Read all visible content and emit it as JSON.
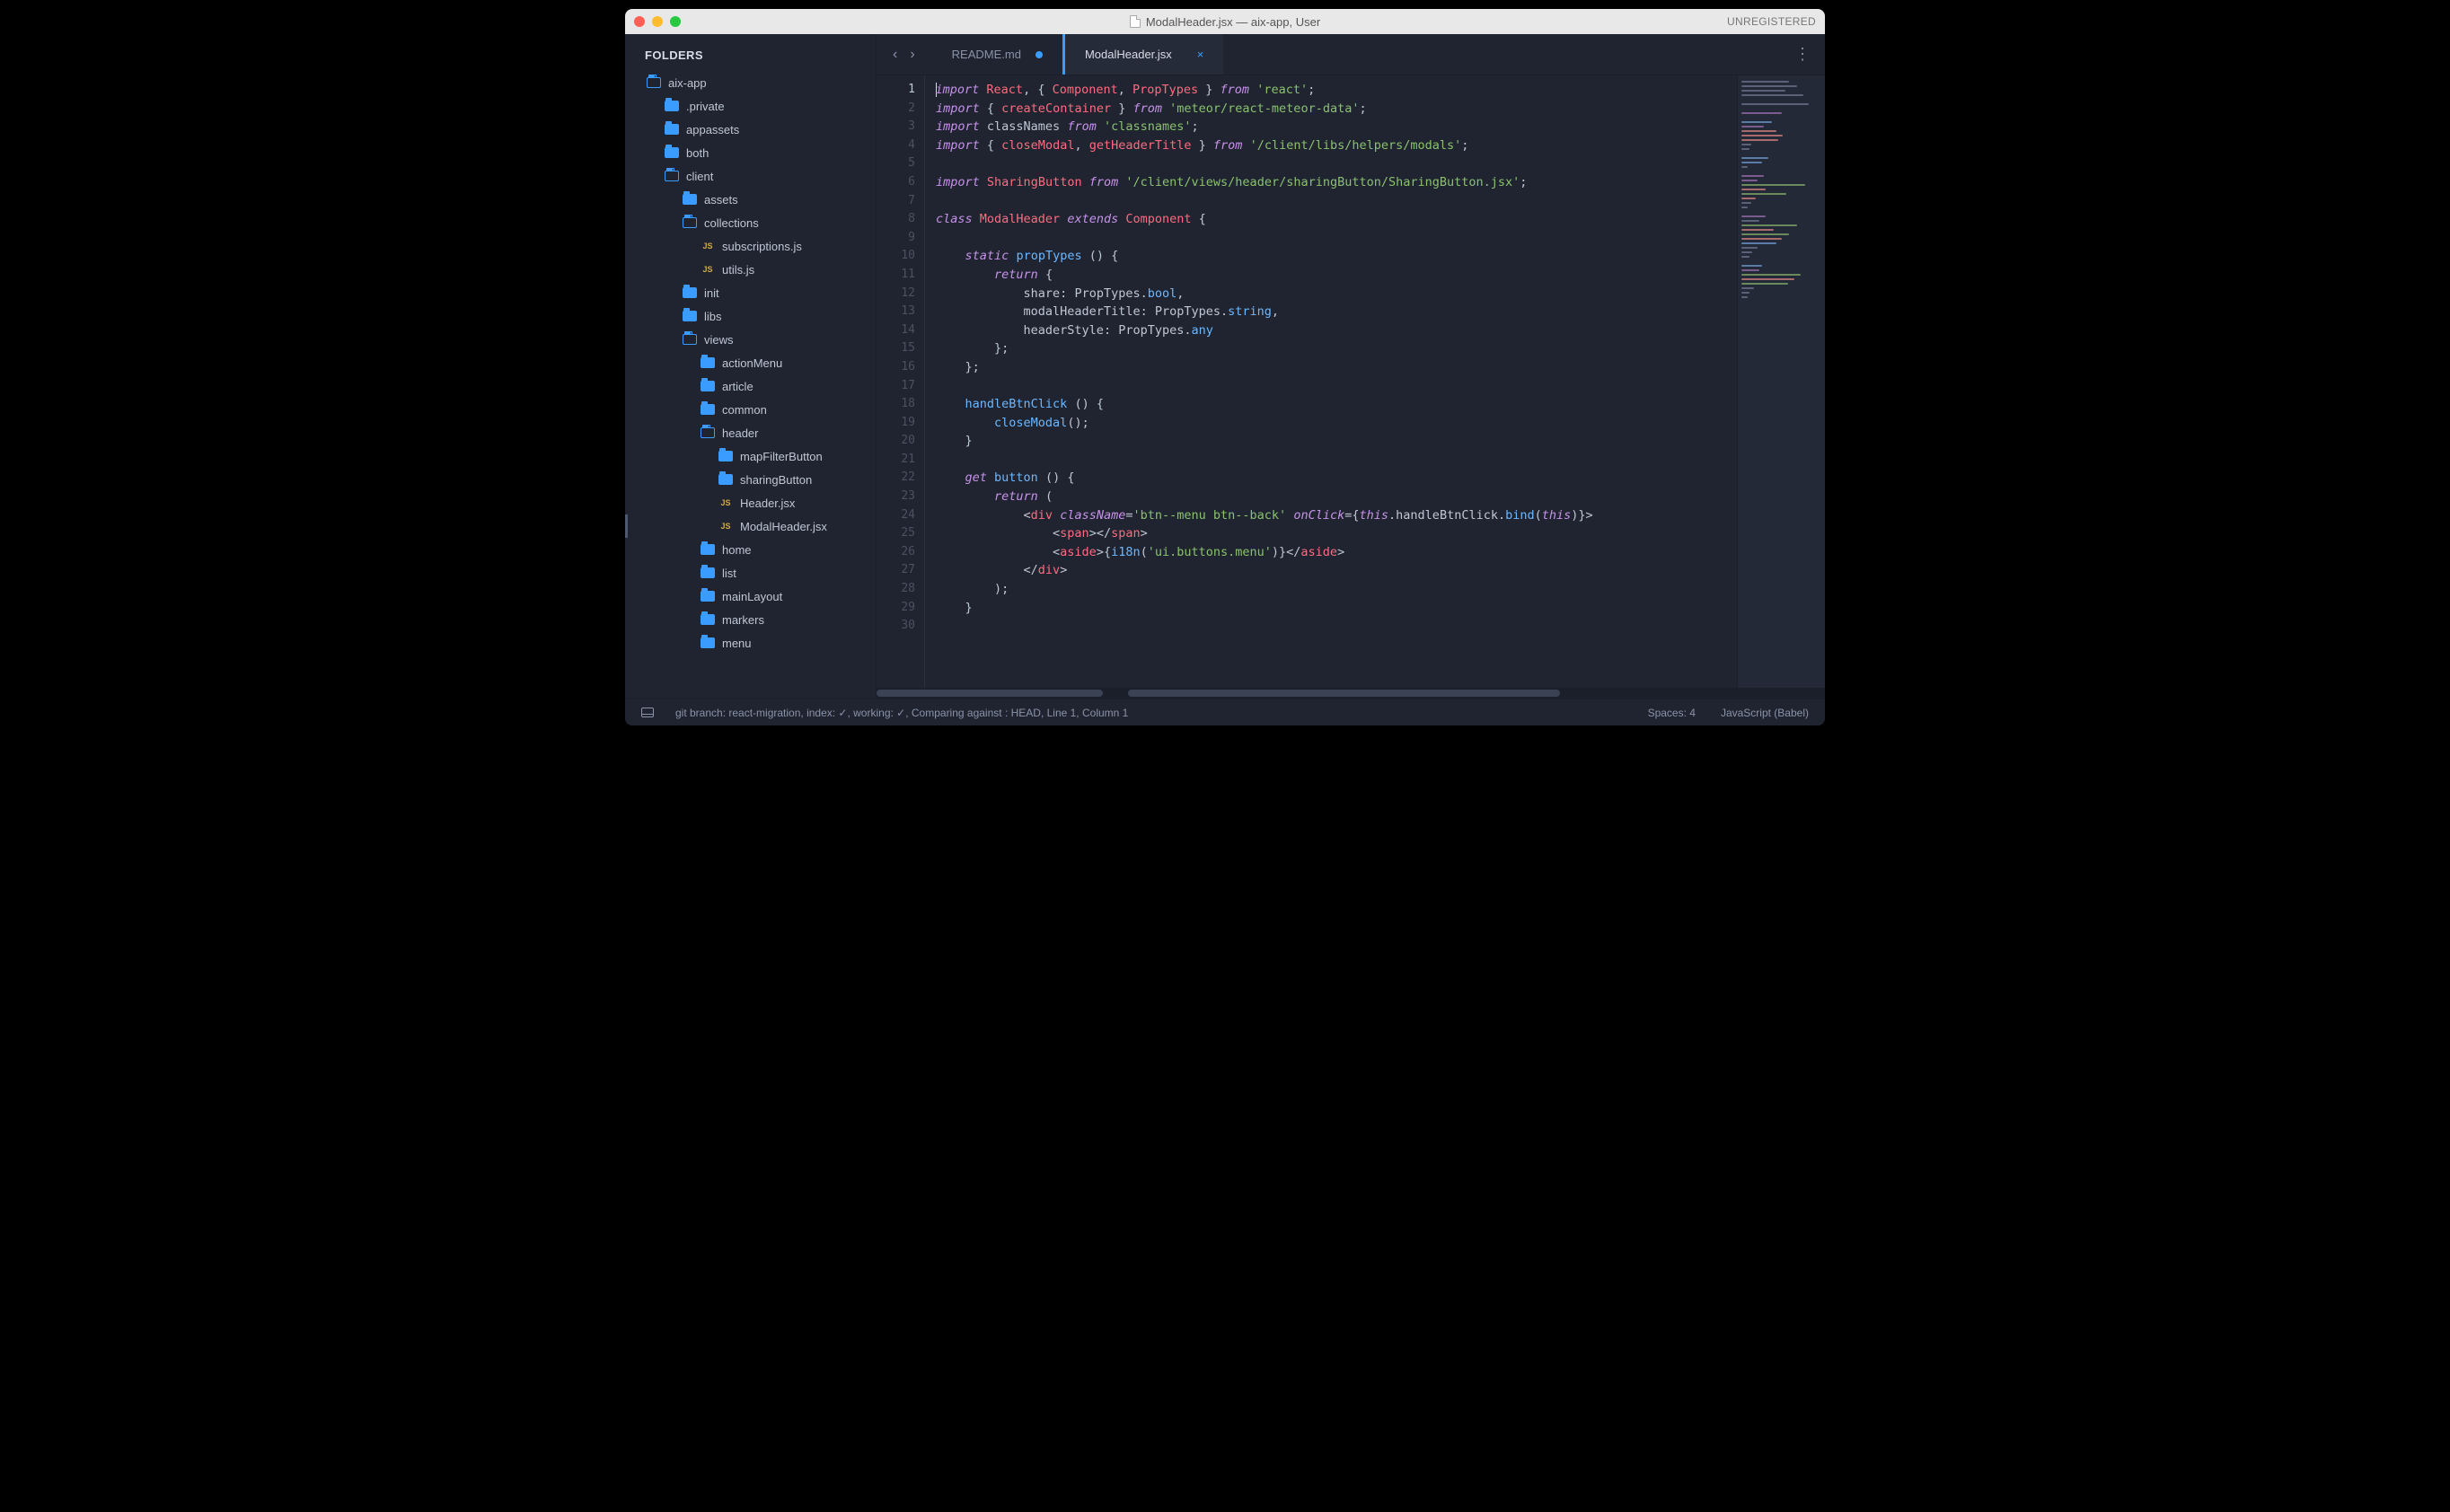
{
  "titlebar": {
    "title": "ModalHeader.jsx — aix-app, User",
    "unregistered": "UNREGISTERED"
  },
  "sidebar": {
    "header": "FOLDERS",
    "tree": [
      {
        "label": "aix-app",
        "type": "folder-open-outline",
        "indent": 24
      },
      {
        "label": ".private",
        "type": "folder",
        "indent": 44
      },
      {
        "label": "appassets",
        "type": "folder",
        "indent": 44
      },
      {
        "label": "both",
        "type": "folder",
        "indent": 44
      },
      {
        "label": "client",
        "type": "folder-open-outline",
        "indent": 44
      },
      {
        "label": "assets",
        "type": "folder",
        "indent": 64
      },
      {
        "label": "collections",
        "type": "folder-open-outline",
        "indent": 64
      },
      {
        "label": "subscriptions.js",
        "type": "js",
        "indent": 84
      },
      {
        "label": "utils.js",
        "type": "js",
        "indent": 84
      },
      {
        "label": "init",
        "type": "folder",
        "indent": 64
      },
      {
        "label": "libs",
        "type": "folder",
        "indent": 64
      },
      {
        "label": "views",
        "type": "folder-open-outline",
        "indent": 64
      },
      {
        "label": "actionMenu",
        "type": "folder",
        "indent": 84
      },
      {
        "label": "article",
        "type": "folder",
        "indent": 84
      },
      {
        "label": "common",
        "type": "folder",
        "indent": 84
      },
      {
        "label": "header",
        "type": "folder-open-outline",
        "indent": 84
      },
      {
        "label": "mapFilterButton",
        "type": "folder",
        "indent": 104
      },
      {
        "label": "sharingButton",
        "type": "folder",
        "indent": 104
      },
      {
        "label": "Header.jsx",
        "type": "js",
        "indent": 104
      },
      {
        "label": "ModalHeader.jsx",
        "type": "js",
        "indent": 104,
        "active": true
      },
      {
        "label": "home",
        "type": "folder",
        "indent": 84
      },
      {
        "label": "list",
        "type": "folder",
        "indent": 84
      },
      {
        "label": "mainLayout",
        "type": "folder",
        "indent": 84
      },
      {
        "label": "markers",
        "type": "folder",
        "indent": 84
      },
      {
        "label": "menu",
        "type": "folder",
        "indent": 84
      }
    ]
  },
  "tabs": [
    {
      "label": "README.md",
      "dirty": true,
      "active": false
    },
    {
      "label": "ModalHeader.jsx",
      "dirty": false,
      "active": true,
      "closable": true
    }
  ],
  "editor": {
    "lines": [
      [
        [
          "c-kw",
          "import"
        ],
        [
          "c-plain",
          " "
        ],
        [
          "c-type",
          "React"
        ],
        [
          "c-plain",
          ", { "
        ],
        [
          "c-type",
          "Component"
        ],
        [
          "c-plain",
          ", "
        ],
        [
          "c-type",
          "PropTypes"
        ],
        [
          "c-plain",
          " } "
        ],
        [
          "c-kw",
          "from"
        ],
        [
          "c-plain",
          " "
        ],
        [
          "c-str",
          "'react'"
        ],
        [
          "c-plain",
          ";"
        ]
      ],
      [
        [
          "c-kw",
          "import"
        ],
        [
          "c-plain",
          " { "
        ],
        [
          "c-type",
          "createContainer"
        ],
        [
          "c-plain",
          " } "
        ],
        [
          "c-kw",
          "from"
        ],
        [
          "c-plain",
          " "
        ],
        [
          "c-str",
          "'meteor/react-meteor-data'"
        ],
        [
          "c-plain",
          ";"
        ]
      ],
      [
        [
          "c-kw",
          "import"
        ],
        [
          "c-plain",
          " classNames "
        ],
        [
          "c-kw",
          "from"
        ],
        [
          "c-plain",
          " "
        ],
        [
          "c-str",
          "'classnames'"
        ],
        [
          "c-plain",
          ";"
        ]
      ],
      [
        [
          "c-kw",
          "import"
        ],
        [
          "c-plain",
          " { "
        ],
        [
          "c-type",
          "closeModal"
        ],
        [
          "c-plain",
          ", "
        ],
        [
          "c-type",
          "getHeaderTitle"
        ],
        [
          "c-plain",
          " } "
        ],
        [
          "c-kw",
          "from"
        ],
        [
          "c-plain",
          " "
        ],
        [
          "c-str",
          "'/client/libs/helpers/modals'"
        ],
        [
          "c-plain",
          ";"
        ]
      ],
      [],
      [
        [
          "c-kw",
          "import"
        ],
        [
          "c-plain",
          " "
        ],
        [
          "c-type",
          "SharingButton"
        ],
        [
          "c-plain",
          " "
        ],
        [
          "c-kw",
          "from"
        ],
        [
          "c-plain",
          " "
        ],
        [
          "c-str",
          "'/client/views/header/sharingButton/SharingButton.jsx'"
        ],
        [
          "c-plain",
          ";"
        ]
      ],
      [],
      [
        [
          "c-kw",
          "class"
        ],
        [
          "c-plain",
          " "
        ],
        [
          "c-type",
          "ModalHeader"
        ],
        [
          "c-plain",
          " "
        ],
        [
          "c-kw",
          "extends"
        ],
        [
          "c-plain",
          " "
        ],
        [
          "c-type",
          "Component"
        ],
        [
          "c-plain",
          " {"
        ]
      ],
      [],
      [
        [
          "c-plain",
          "    "
        ],
        [
          "c-kw",
          "static"
        ],
        [
          "c-plain",
          " "
        ],
        [
          "c-func",
          "propTypes"
        ],
        [
          "c-plain",
          " () {"
        ]
      ],
      [
        [
          "c-plain",
          "        "
        ],
        [
          "c-kw",
          "return"
        ],
        [
          "c-plain",
          " {"
        ]
      ],
      [
        [
          "c-plain",
          "            share"
        ],
        [
          "c-punc",
          ": "
        ],
        [
          "c-plain",
          "PropTypes"
        ],
        [
          "c-punc",
          "."
        ],
        [
          "c-func",
          "bool"
        ],
        [
          "c-punc",
          ","
        ]
      ],
      [
        [
          "c-plain",
          "            modalHeaderTitle"
        ],
        [
          "c-punc",
          ": "
        ],
        [
          "c-plain",
          "PropTypes"
        ],
        [
          "c-punc",
          "."
        ],
        [
          "c-func",
          "string"
        ],
        [
          "c-punc",
          ","
        ]
      ],
      [
        [
          "c-plain",
          "            headerStyle"
        ],
        [
          "c-punc",
          ": "
        ],
        [
          "c-plain",
          "PropTypes"
        ],
        [
          "c-punc",
          "."
        ],
        [
          "c-func",
          "any"
        ]
      ],
      [
        [
          "c-plain",
          "        };"
        ]
      ],
      [
        [
          "c-plain",
          "    };"
        ]
      ],
      [],
      [
        [
          "c-plain",
          "    "
        ],
        [
          "c-func",
          "handleBtnClick"
        ],
        [
          "c-plain",
          " () {"
        ]
      ],
      [
        [
          "c-plain",
          "        "
        ],
        [
          "c-func",
          "closeModal"
        ],
        [
          "c-plain",
          "();"
        ]
      ],
      [
        [
          "c-plain",
          "    }"
        ]
      ],
      [],
      [
        [
          "c-plain",
          "    "
        ],
        [
          "c-kw",
          "get"
        ],
        [
          "c-plain",
          " "
        ],
        [
          "c-func",
          "button"
        ],
        [
          "c-plain",
          " () {"
        ]
      ],
      [
        [
          "c-plain",
          "        "
        ],
        [
          "c-kw",
          "return"
        ],
        [
          "c-plain",
          " ("
        ]
      ],
      [
        [
          "c-plain",
          "            <"
        ],
        [
          "c-html",
          "div"
        ],
        [
          "c-plain",
          " "
        ],
        [
          "c-attr",
          "className"
        ],
        [
          "c-punc",
          "="
        ],
        [
          "c-str",
          "'btn--menu btn--back'"
        ],
        [
          "c-plain",
          " "
        ],
        [
          "c-attr",
          "onClick"
        ],
        [
          "c-punc",
          "="
        ],
        [
          "c-plain",
          "{"
        ],
        [
          "c-this",
          "this"
        ],
        [
          "c-punc",
          "."
        ],
        [
          "c-plain",
          "handleBtnClick"
        ],
        [
          "c-punc",
          "."
        ],
        [
          "c-func",
          "bind"
        ],
        [
          "c-plain",
          "("
        ],
        [
          "c-this",
          "this"
        ],
        [
          "c-plain",
          ")}>"
        ]
      ],
      [
        [
          "c-plain",
          "                <"
        ],
        [
          "c-html",
          "span"
        ],
        [
          "c-plain",
          "></"
        ],
        [
          "c-html",
          "span"
        ],
        [
          "c-plain",
          ">"
        ]
      ],
      [
        [
          "c-plain",
          "                <"
        ],
        [
          "c-html",
          "aside"
        ],
        [
          "c-plain",
          ">{"
        ],
        [
          "c-func",
          "i18n"
        ],
        [
          "c-plain",
          "("
        ],
        [
          "c-str",
          "'ui.buttons.menu'"
        ],
        [
          "c-plain",
          ")}</"
        ],
        [
          "c-html",
          "aside"
        ],
        [
          "c-plain",
          ">"
        ]
      ],
      [
        [
          "c-plain",
          "            </"
        ],
        [
          "c-html",
          "div"
        ],
        [
          "c-plain",
          ">"
        ]
      ],
      [
        [
          "c-plain",
          "        );"
        ]
      ],
      [
        [
          "c-plain",
          "    }"
        ]
      ],
      []
    ],
    "line_count": 30,
    "current_line": 1
  },
  "statusbar": {
    "left": "git branch: react-migration, index: ✓, working: ✓, Comparing against : HEAD, Line 1, Column 1",
    "spaces": "Spaces: 4",
    "syntax": "JavaScript (Babel)"
  },
  "minimap": [
    {
      "w": 60,
      "c": "#5a6278"
    },
    {
      "w": 70,
      "c": "#5a6278"
    },
    {
      "w": 55,
      "c": "#5a6278"
    },
    {
      "w": 78,
      "c": "#5a6278"
    },
    {
      "w": 0,
      "c": ""
    },
    {
      "w": 84,
      "c": "#5a6278"
    },
    {
      "w": 0,
      "c": ""
    },
    {
      "w": 50,
      "c": "#7b5c8f"
    },
    {
      "w": 0,
      "c": ""
    },
    {
      "w": 38,
      "c": "#5a7ba8"
    },
    {
      "w": 28,
      "c": "#7b5c8f"
    },
    {
      "w": 44,
      "c": "#a86b6b"
    },
    {
      "w": 52,
      "c": "#a86b6b"
    },
    {
      "w": 46,
      "c": "#a86b6b"
    },
    {
      "w": 12,
      "c": "#5a6278"
    },
    {
      "w": 10,
      "c": "#5a6278"
    },
    {
      "w": 0,
      "c": ""
    },
    {
      "w": 34,
      "c": "#5a7ba8"
    },
    {
      "w": 26,
      "c": "#5a7ba8"
    },
    {
      "w": 8,
      "c": "#5a6278"
    },
    {
      "w": 0,
      "c": ""
    },
    {
      "w": 28,
      "c": "#7b5c8f"
    },
    {
      "w": 20,
      "c": "#7b5c8f"
    },
    {
      "w": 80,
      "c": "#6b8a5c"
    },
    {
      "w": 30,
      "c": "#a86b6b"
    },
    {
      "w": 56,
      "c": "#6b8a5c"
    },
    {
      "w": 18,
      "c": "#a86b6b"
    },
    {
      "w": 12,
      "c": "#5a6278"
    },
    {
      "w": 8,
      "c": "#5a6278"
    },
    {
      "w": 0,
      "c": ""
    },
    {
      "w": 30,
      "c": "#7b5c8f"
    },
    {
      "w": 22,
      "c": "#5a6278"
    },
    {
      "w": 70,
      "c": "#6b8a5c"
    },
    {
      "w": 40,
      "c": "#a86b6b"
    },
    {
      "w": 60,
      "c": "#6b8a5c"
    },
    {
      "w": 50,
      "c": "#a86b6b"
    },
    {
      "w": 44,
      "c": "#5a7ba8"
    },
    {
      "w": 20,
      "c": "#5a6278"
    },
    {
      "w": 14,
      "c": "#5a6278"
    },
    {
      "w": 10,
      "c": "#5a6278"
    },
    {
      "w": 0,
      "c": ""
    },
    {
      "w": 26,
      "c": "#5a7ba8"
    },
    {
      "w": 22,
      "c": "#7b5c8f"
    },
    {
      "w": 74,
      "c": "#6b8a5c"
    },
    {
      "w": 66,
      "c": "#a86b6b"
    },
    {
      "w": 58,
      "c": "#6b8a5c"
    },
    {
      "w": 16,
      "c": "#5a6278"
    },
    {
      "w": 10,
      "c": "#5a6278"
    },
    {
      "w": 8,
      "c": "#5a6278"
    }
  ]
}
